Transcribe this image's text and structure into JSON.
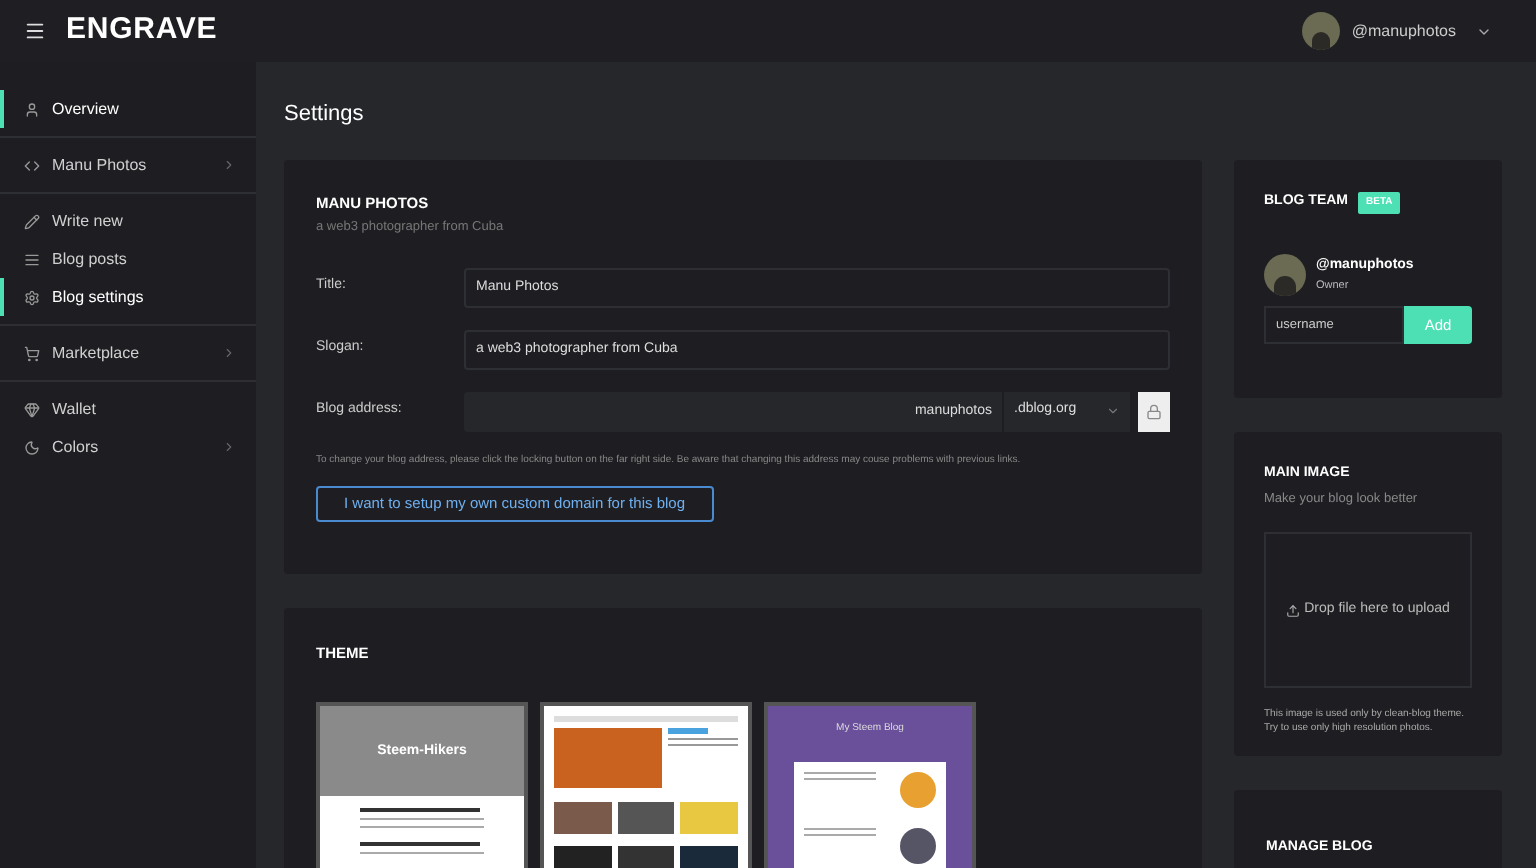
{
  "header": {
    "logo": "ENGRAVE",
    "user": "@manuphotos"
  },
  "sidebar": {
    "groups": [
      {
        "items": [
          {
            "label": "Overview",
            "selected": true,
            "expandable": false
          }
        ]
      },
      {
        "items": [
          {
            "label": "Manu Photos",
            "selected": false,
            "expandable": true
          }
        ]
      },
      {
        "items": [
          {
            "label": "Write new",
            "selected": false,
            "expandable": false
          },
          {
            "label": "Blog posts",
            "selected": false,
            "expandable": false
          },
          {
            "label": "Blog settings",
            "selected": true,
            "expandable": false
          }
        ]
      },
      {
        "items": [
          {
            "label": "Marketplace",
            "selected": false,
            "expandable": true
          }
        ]
      },
      {
        "items": [
          {
            "label": "Wallet",
            "selected": false,
            "expandable": false
          },
          {
            "label": "Colors",
            "selected": false,
            "expandable": true
          }
        ]
      }
    ]
  },
  "page_title": "Settings",
  "blog_card": {
    "name": "MANU PHOTOS",
    "tagline": "a web3 photographer from Cuba",
    "fields": [
      {
        "label": "Title:",
        "value": "Manu Photos"
      },
      {
        "label": "Slogan:",
        "value": "a web3 photographer from Cuba"
      }
    ],
    "address": {
      "label": "Blog address:",
      "value": "manuphotos",
      "domain": ".dblog.org",
      "locked": true
    },
    "note": "To change your blog address, please click the locking button on the far right side. Be aware that changing this address may couse problems with previous links.",
    "custom_domain_button": "I want to setup my own custom domain for this blog"
  },
  "theme_card": {
    "title": "THEME",
    "themes": [
      {
        "kind": "hikers",
        "title": "Steem-Hikers"
      },
      {
        "kind": "magazine"
      },
      {
        "kind": "clean",
        "title": "My Steem Blog"
      }
    ]
  },
  "blog_team": {
    "title": "BLOG TEAM",
    "badge": "BETA",
    "member": {
      "name": "@manuphotos",
      "role": "Owner"
    },
    "input_value": "username",
    "add_button": "Add"
  },
  "main_image": {
    "title": "MAIN IMAGE",
    "subtitle": "Make your blog look better",
    "dropzone": "Drop file here to upload",
    "note_lines": [
      "This image is used only by clean-blog theme.",
      "Try to use only high resolution photos."
    ]
  },
  "manage_blog": {
    "title": "MANAGE BLOG"
  }
}
